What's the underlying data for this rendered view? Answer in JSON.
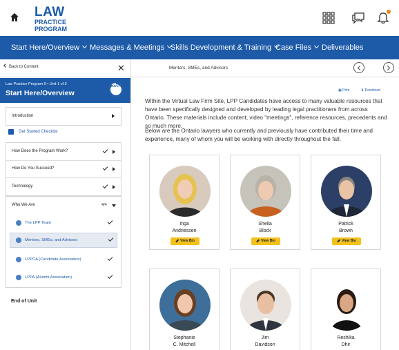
{
  "header": {
    "logo_line1": "LAW",
    "logo_line2": "PRACTICE",
    "logo_line3": "PROGRAM",
    "icons": [
      "home-icon",
      "apps-grid-icon",
      "messages-icon",
      "bell-icon"
    ],
    "notification_color": "#e58a1e"
  },
  "nav": {
    "items": [
      {
        "label": "Start Here/Overview"
      },
      {
        "label": "Messages & Meetings"
      },
      {
        "label": "Skills Development & Training"
      },
      {
        "label": "Case Files"
      },
      {
        "label": "Deliverables"
      }
    ],
    "color": "#1d5aa8"
  },
  "subbar": {
    "back_label": "Back to Content",
    "page_title": "Mentors, SMEs, and Advisors"
  },
  "sidebar": {
    "unit_sub": "Law Practice Program 9  •  Unit 1 of 5",
    "unit_title": "Start Here/Overview",
    "progress": "15/17",
    "progress_fraction": 0.88,
    "introduction": "Introduction",
    "checklist": "Get Started Checklist",
    "sections": [
      {
        "label": "How Does the Program Work?"
      },
      {
        "label": "How Do You Succeed?"
      },
      {
        "label": "Technology"
      }
    ],
    "who_we_are": {
      "label": "Who We Are",
      "count": "4/4",
      "items": [
        {
          "label": "The LPP Team"
        },
        {
          "label": "Mentors, SMEs, and Advisors"
        },
        {
          "label": "LPPCA (Candidate Association)"
        },
        {
          "label": "LPPA (Alumni Association)"
        }
      ]
    },
    "end_label": "End of Unit"
  },
  "main": {
    "print_label": "Print",
    "download_label": "Download",
    "para1": "Within the Virtual Law Firm Site, LPP Candidates have access to many valuable resources that have been specifically designed and developed by leading legal practitioners from across Ontario. These materials include content, video \"meetings\", reference resources, precedents and so much more.",
    "para2": "Below are the Ontario lawyers who currently and  previously have contributed their time and experience, many of whom you will be working with directly throughout the fall.",
    "bio_label": "View Bio",
    "people": [
      {
        "first": "Inga",
        "last": "Andriessen"
      },
      {
        "first": "Sheila",
        "last": "Block"
      },
      {
        "first": "Patrick",
        "last": "Brown"
      },
      {
        "first": "Stephanie",
        "last": "C. Mitchell"
      },
      {
        "first": "Jim",
        "last": "Davidson"
      },
      {
        "first": "Reshika",
        "last": "Dhir"
      }
    ]
  }
}
